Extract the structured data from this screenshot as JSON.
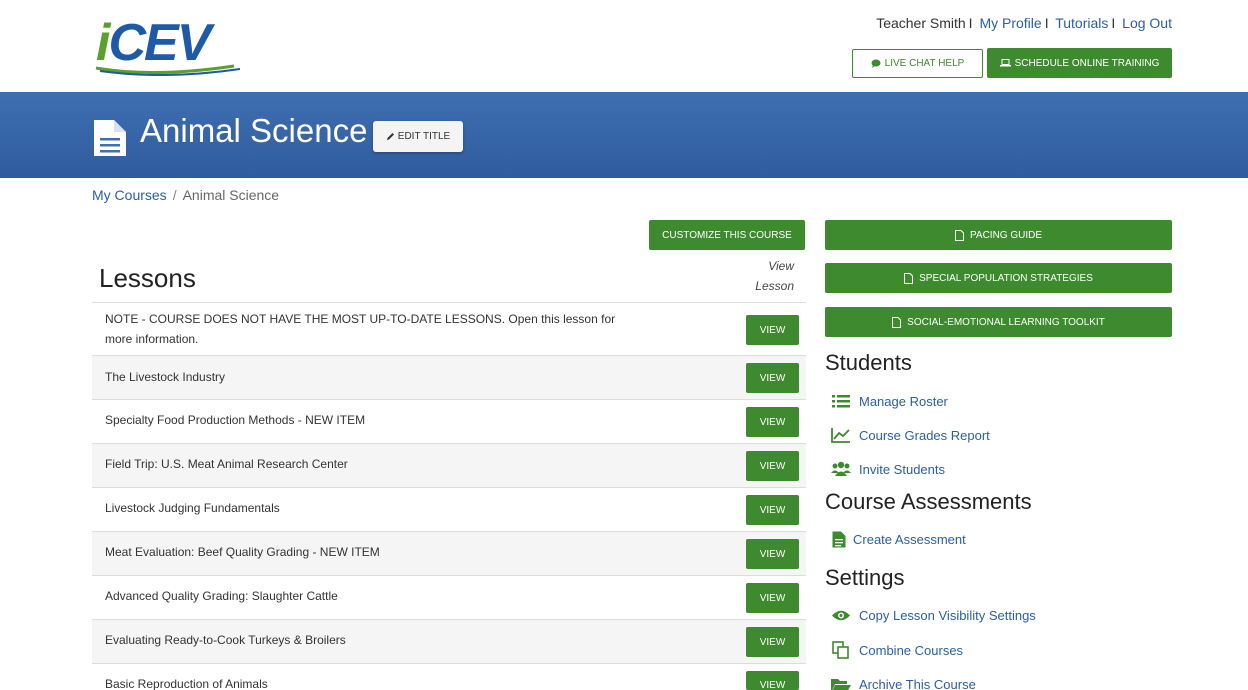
{
  "header": {
    "logo_text": "iCEV",
    "user_name": "Teacher Smith",
    "links": [
      "My Profile",
      "Tutorials",
      "Log Out"
    ],
    "live_chat_label": "LIVE CHAT HELP",
    "schedule_label": "SCHEDULE ONLINE TRAINING"
  },
  "banner": {
    "course_title": "Animal Science",
    "edit_title_label": "EDIT TITLE"
  },
  "breadcrumb": {
    "home": "My Courses",
    "current": "Animal Science"
  },
  "lessons": {
    "customize_label": "CUSTOMIZE THIS COURSE",
    "heading": "Lessons",
    "view_col_line1": "View",
    "view_col_line2": "Lesson",
    "view_label": "VIEW",
    "rows": [
      "NOTE - COURSE DOES NOT HAVE THE MOST UP-TO-DATE LESSONS. Open this lesson for more information.",
      "The Livestock Industry",
      "Specialty Food Production Methods - NEW ITEM",
      "Field Trip: U.S. Meat Animal Research Center",
      "Livestock Judging Fundamentals",
      "Meat Evaluation: Beef Quality Grading - NEW ITEM",
      "Advanced Quality Grading: Slaughter Cattle",
      "Evaluating Ready-to-Cook Turkeys & Broilers",
      "Basic Reproduction of Animals"
    ]
  },
  "sidebar": {
    "pacing_guide": "PACING GUIDE",
    "special_population": "SPECIAL POPULATION STRATEGIES",
    "sel_toolkit": "SOCIAL-EMOTIONAL LEARNING TOOLKIT",
    "students_heading": "Students",
    "manage_roster": "Manage Roster",
    "grades_report": "Course Grades Report",
    "invite_students": "Invite Students",
    "assessments_heading": "Course Assessments",
    "create_assessment": "Create Assessment",
    "settings_heading": "Settings",
    "copy_visibility": "Copy Lesson Visibility Settings",
    "combine_courses": "Combine Courses",
    "archive_course": "Archive This Course"
  },
  "colors": {
    "brand_green": "#3d8b2e",
    "brand_blue": "#2f5c9e",
    "link_blue": "#2a5ea8"
  }
}
